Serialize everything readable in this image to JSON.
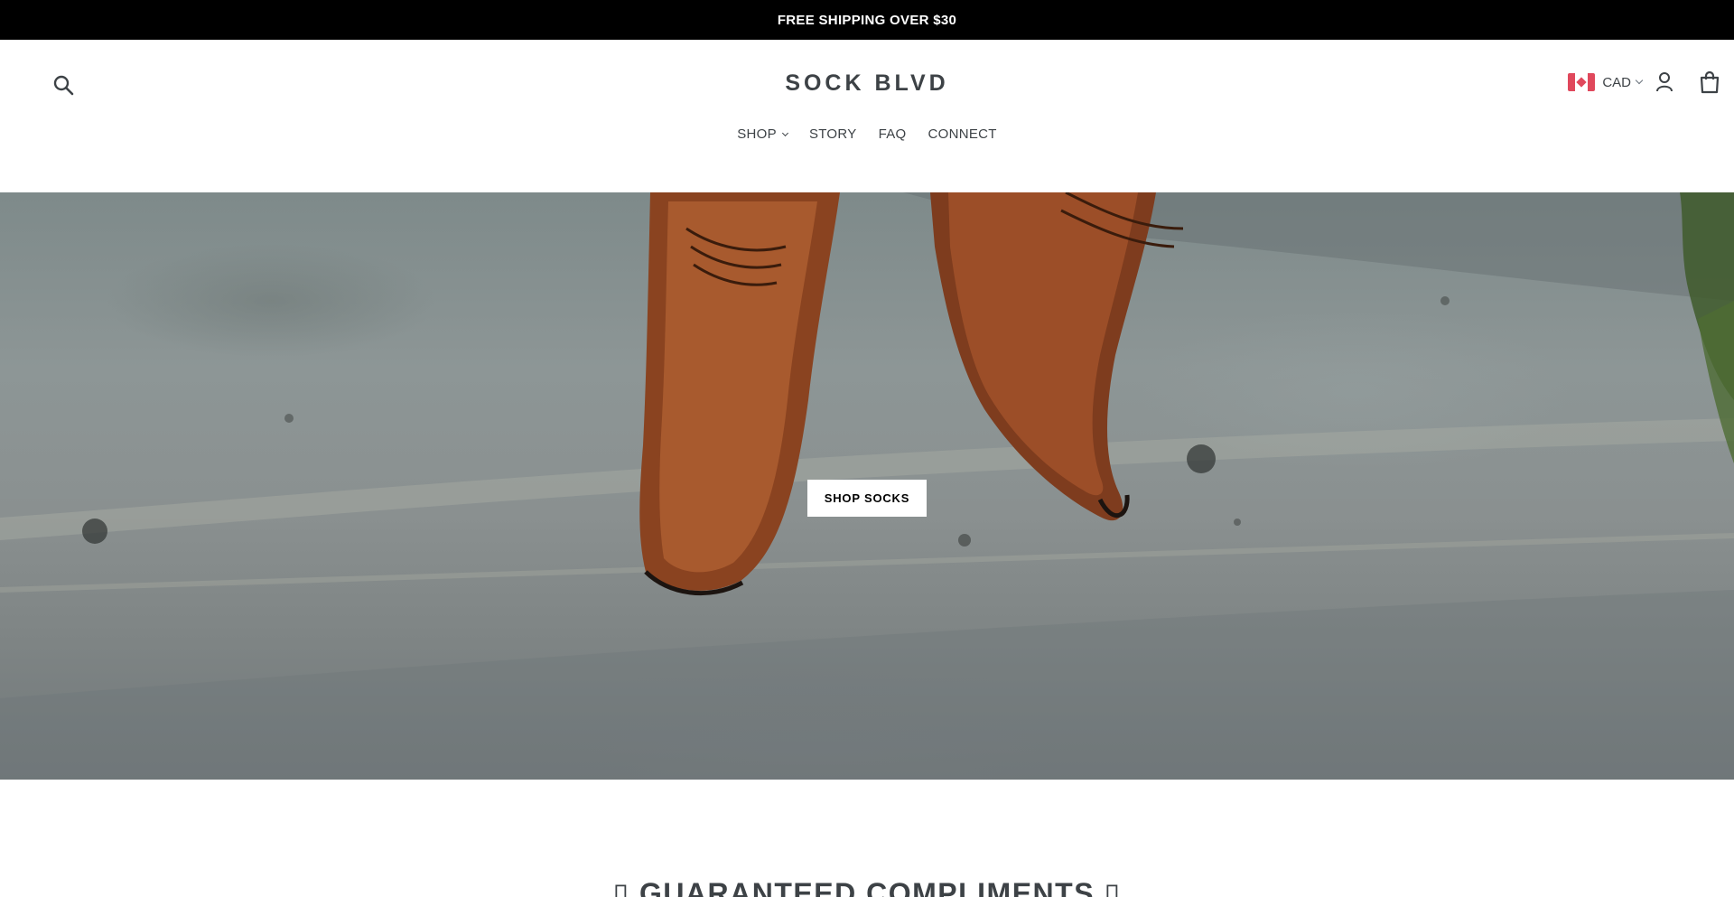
{
  "announcement": {
    "text": "FREE SHIPPING OVER $30"
  },
  "header": {
    "logo": "SOCK BLVD",
    "currency": {
      "code": "CAD",
      "flag": "canada-flag-icon"
    },
    "icons": [
      "search-icon",
      "account-icon",
      "cart-icon"
    ]
  },
  "nav": {
    "items": [
      {
        "label": "SHOP",
        "has_dropdown": true
      },
      {
        "label": "STORY",
        "has_dropdown": false
      },
      {
        "label": "FAQ",
        "has_dropdown": false
      },
      {
        "label": "CONNECT",
        "has_dropdown": false
      }
    ]
  },
  "hero": {
    "button_label": "SHOP SOCKS"
  },
  "section": {
    "title": "▯ GUARANTEED COMPLIMENTS ▯"
  },
  "colors": {
    "accent": "#000000",
    "text": "#3d4246",
    "flag_red": "#e0485c"
  }
}
